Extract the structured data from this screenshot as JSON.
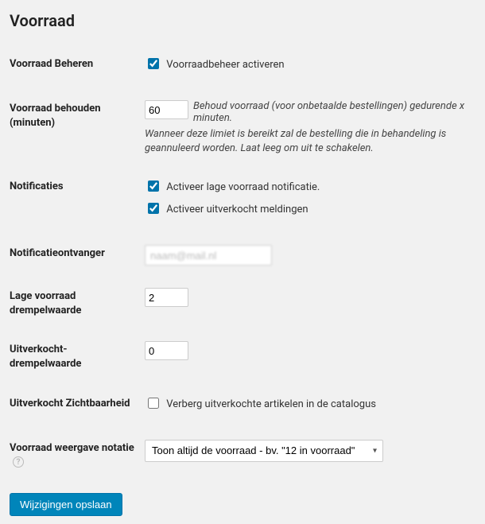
{
  "page_title": "Voorraad",
  "rows": {
    "manage_stock": {
      "label": "Voorraad Beheren",
      "checkbox_label": "Voorraadbeheer activeren",
      "checked": true
    },
    "hold_stock": {
      "label": "Voorraad behouden (minuten)",
      "value": "60",
      "desc_inline": "Behoud voorraad (voor onbetaalde bestellingen) gedurende x minuten.",
      "desc_block": "Wanneer deze limiet is bereikt zal de bestelling die in behandeling is geannuleerd worden. Laat leeg om uit te schakelen."
    },
    "notifications": {
      "label": "Notificaties",
      "low_stock_label": "Activeer lage voorraad notificatie.",
      "low_stock_checked": true,
      "out_of_stock_label": "Activeer uitverkocht meldingen",
      "out_of_stock_checked": true
    },
    "recipient": {
      "label": "Notificatieontvanger",
      "value": "naam@mail.nl"
    },
    "low_threshold": {
      "label": "Lage voorraad drempelwaarde",
      "value": "2"
    },
    "out_threshold": {
      "label": "Uitverkocht-drempelwaarde",
      "value": "0"
    },
    "out_visibility": {
      "label": "Uitverkocht Zichtbaarheid",
      "checkbox_label": "Verberg uitverkochte artikelen in de catalogus",
      "checked": false
    },
    "stock_display": {
      "label": "Voorraad weergave notatie",
      "selected": "Toon altijd de voorraad - bv. \"12 in voorraad\""
    }
  },
  "submit_label": "Wijzigingen opslaan",
  "help_glyph": "?"
}
